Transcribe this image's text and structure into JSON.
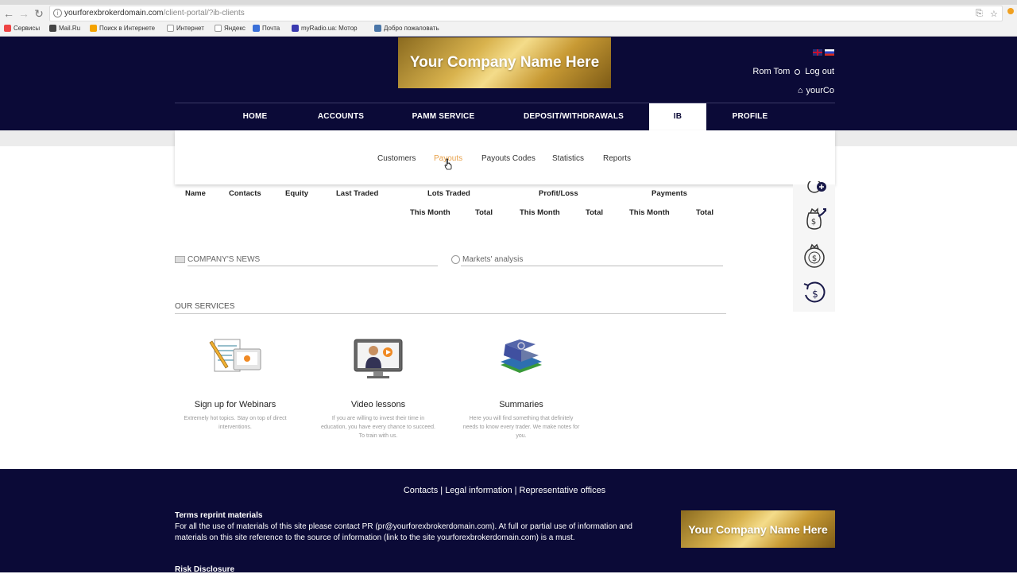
{
  "browser": {
    "url_host": "yourforexbrokerdomain.com",
    "url_path": "/client-portal/?ib-clients",
    "bookmarks": [
      "Сервисы",
      "Mail.Ru",
      "Поиск в Интернете",
      "Интернет",
      "Яндекс",
      "Почта",
      "myRadio.ua: Мотор",
      "Добро пожаловать"
    ]
  },
  "header": {
    "logo_text": "Your Company Name Here",
    "user_name": "Rom Tom",
    "logout": "Log out",
    "home_label": "yourCo"
  },
  "nav": {
    "items": [
      "HOME",
      "ACCOUNTS",
      "PAMM SERVICE",
      "DEPOSIT/WITHDRAWALS",
      "IB",
      "PROFILE"
    ],
    "active": "IB"
  },
  "submenu": {
    "items": [
      "Customers",
      "Payouts",
      "Payouts Codes",
      "Statistics",
      "Reports"
    ],
    "active": "Payouts"
  },
  "table": {
    "headers": [
      "Name",
      "Contacts",
      "Equity",
      "Last Traded",
      "Lots Traded",
      "Profit/Loss",
      "Payments"
    ],
    "subheaders": [
      "This Month",
      "Total",
      "This Month",
      "Total",
      "This Month",
      "Total"
    ]
  },
  "news": {
    "company_news": "COMPANY'S NEWS",
    "markets": "Markets' analysis"
  },
  "services": {
    "title": "OUR SERVICES",
    "items": [
      {
        "title": "Sign up for Webinars",
        "desc": "Extremely hot topics. Stay on top of direct interventions."
      },
      {
        "title": "Video lessons",
        "desc": "If you are willing to invest their time in education, you have every chance to succeed. To train with us."
      },
      {
        "title": "Summaries",
        "desc": "Here you will find something that definitely needs to know every trader. We make notes for you."
      }
    ]
  },
  "footer": {
    "links": "Contacts | Legal information | Representative offices",
    "terms_title": "Terms reprint materials",
    "terms_text": "For all the use of materials of this site please contact PR (pr@yourforexbrokerdomain.com). At full or partial use of information and materials on this site reference to the source of information (link to the site yourforexbrokerdomain.com) is a must.",
    "risk": "Risk Disclosure",
    "logo_text": "Your Company Name Here"
  },
  "colors": {
    "brand_navy": "#0b0a37",
    "gold": "#d8b24d",
    "active_submenu": "#e8a14a"
  }
}
